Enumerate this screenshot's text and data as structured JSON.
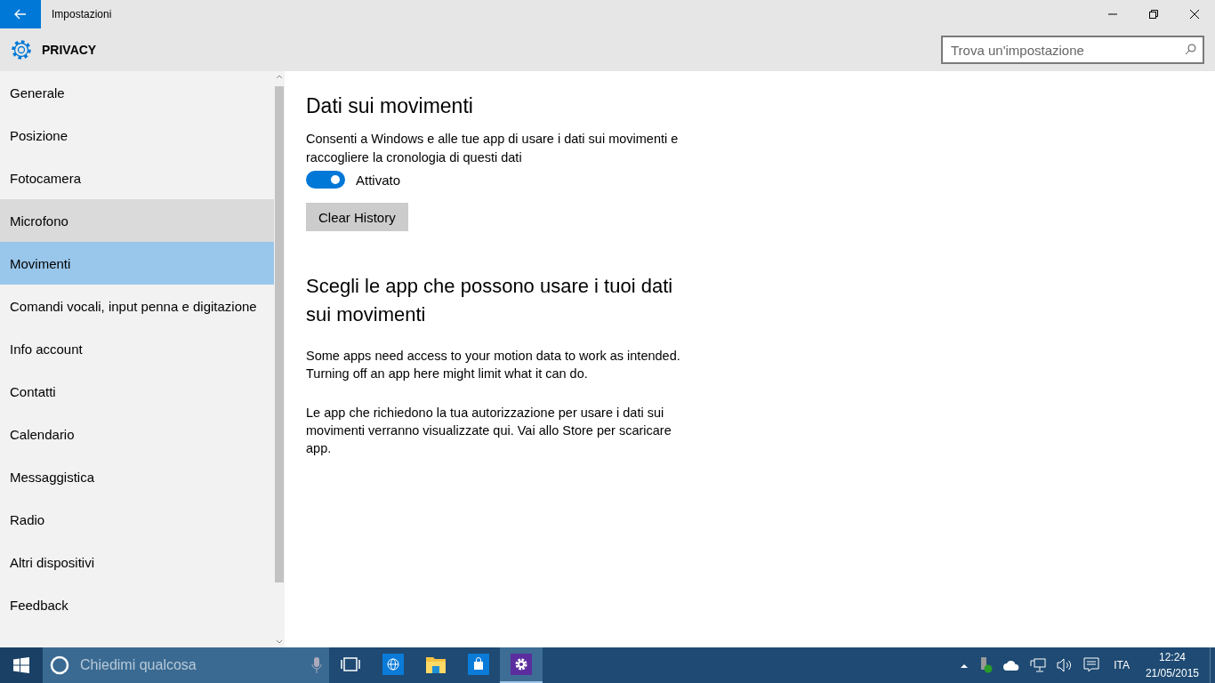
{
  "window": {
    "title": "Impostazioni"
  },
  "header": {
    "title": "PRIVACY",
    "search": {
      "placeholder": "Trova un'impostazione"
    }
  },
  "sidebar": {
    "items": [
      {
        "label": "Generale",
        "selected": false,
        "hovered": false
      },
      {
        "label": "Posizione",
        "selected": false,
        "hovered": false
      },
      {
        "label": "Fotocamera",
        "selected": false,
        "hovered": false
      },
      {
        "label": "Microfono",
        "selected": false,
        "hovered": true
      },
      {
        "label": "Movimenti",
        "selected": true,
        "hovered": false
      },
      {
        "label": "Comandi vocali, input penna e digitazione",
        "selected": false,
        "hovered": false
      },
      {
        "label": "Info account",
        "selected": false,
        "hovered": false
      },
      {
        "label": "Contatti",
        "selected": false,
        "hovered": false
      },
      {
        "label": "Calendario",
        "selected": false,
        "hovered": false
      },
      {
        "label": "Messaggistica",
        "selected": false,
        "hovered": false
      },
      {
        "label": "Radio",
        "selected": false,
        "hovered": false
      },
      {
        "label": "Altri dispositivi",
        "selected": false,
        "hovered": false
      },
      {
        "label": "Feedback",
        "selected": false,
        "hovered": false
      }
    ]
  },
  "content": {
    "section1": {
      "heading": "Dati sui movimenti",
      "description": "Consenti a Windows e alle tue app di usare i dati sui movimenti e raccogliere la cronologia di questi dati",
      "toggle": {
        "on": true,
        "label": "Attivato"
      },
      "button": "Clear History"
    },
    "section2": {
      "heading": "Scegli le app che possono usare i tuoi dati sui movimenti",
      "paragraphs": [
        "Some apps need access to your motion data to work as intended. Turning off an app here might limit what it can do.",
        "Le app che richiedono la tua autorizzazione per usare i dati sui movimenti verranno visualizzate qui. Vai allo Store per scaricare app."
      ]
    }
  },
  "taskbar": {
    "search": {
      "placeholder": "Chiedimi qualcosa"
    },
    "apps": [
      {
        "kind": "taskview",
        "selected": false
      },
      {
        "kind": "browser",
        "selected": false
      },
      {
        "kind": "folder",
        "selected": false
      },
      {
        "kind": "store",
        "selected": false
      },
      {
        "kind": "settings",
        "selected": true
      }
    ],
    "language": "ITA",
    "time": "12:24",
    "date": "21/05/2015"
  }
}
